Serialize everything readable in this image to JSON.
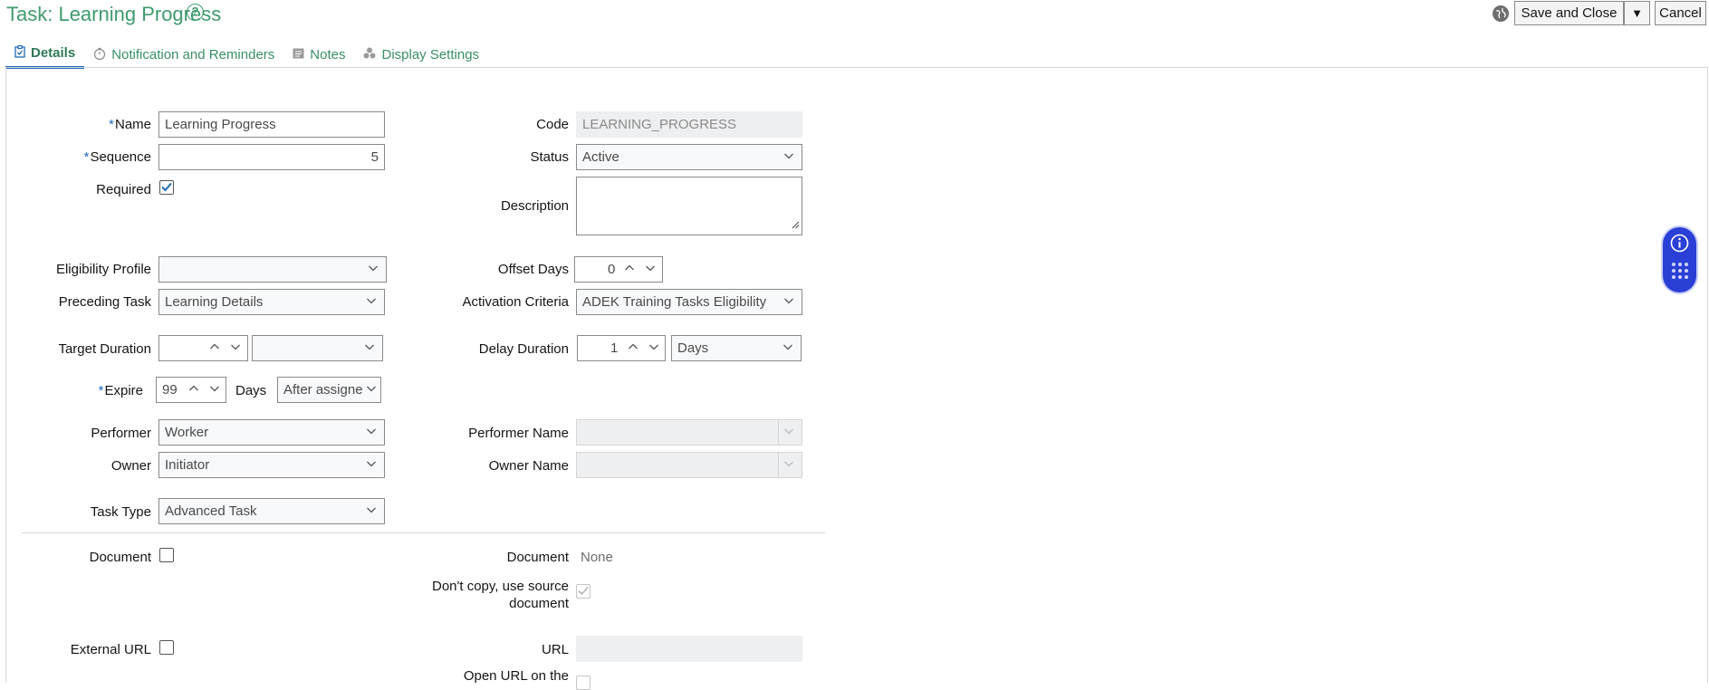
{
  "header": {
    "title": "Task: Learning Progress",
    "help_icon": "help-circle-icon",
    "globe_icon": "globe-icon",
    "save_close_label": "Save and Close",
    "save_menu_glyph": "▼",
    "cancel_label": "Cancel"
  },
  "tabs": [
    {
      "label": "Details",
      "icon": "clipboard-icon",
      "active": true
    },
    {
      "label": "Notification and Reminders",
      "icon": "timer-icon",
      "active": false
    },
    {
      "label": "Notes",
      "icon": "note-icon",
      "active": false
    },
    {
      "label": "Display Settings",
      "icon": "settings-cluster-icon",
      "active": false
    }
  ],
  "form": {
    "name": {
      "label": "Name",
      "required": true,
      "value": "Learning Progress"
    },
    "sequence": {
      "label": "Sequence",
      "required": true,
      "value": "5"
    },
    "required": {
      "label": "Required",
      "checked": true
    },
    "code": {
      "label": "Code",
      "value": "LEARNING_PROGRESS"
    },
    "status": {
      "label": "Status",
      "value": "Active"
    },
    "description": {
      "label": "Description",
      "value": ""
    },
    "eligibility_profile": {
      "label": "Eligibility Profile",
      "value": ""
    },
    "preceding_task": {
      "label": "Preceding Task",
      "value": "Learning Details"
    },
    "offset_days": {
      "label": "Offset Days",
      "value": "0"
    },
    "activation_criteria": {
      "label": "Activation Criteria",
      "value": "ADEK Training Tasks Eligibility"
    },
    "target_duration": {
      "label": "Target Duration",
      "value": "",
      "unit": ""
    },
    "delay_duration": {
      "label": "Delay Duration",
      "value": "1",
      "unit": "Days"
    },
    "expire": {
      "label": "Expire",
      "required": true,
      "value": "99",
      "unit_label": "Days",
      "relative": "After assigne"
    },
    "performer": {
      "label": "Performer",
      "value": "Worker"
    },
    "performer_name": {
      "label": "Performer Name",
      "value": ""
    },
    "owner": {
      "label": "Owner",
      "value": "Initiator"
    },
    "owner_name": {
      "label": "Owner Name",
      "value": ""
    },
    "task_type": {
      "label": "Task Type",
      "value": "Advanced Task"
    },
    "document_check": {
      "label": "Document",
      "checked": false
    },
    "document_value": {
      "label": "Document",
      "value": "None"
    },
    "dont_copy": {
      "label_line1": "Don't copy, use source",
      "label_line2": "document",
      "checked": true
    },
    "external_url": {
      "label": "External URL",
      "checked": false
    },
    "url": {
      "label": "URL",
      "value": ""
    },
    "open_url": {
      "label": "Open URL on the"
    }
  },
  "colors": {
    "accent_green": "#3f9b6e",
    "tab_underline": "#1e6ab8",
    "required_star": "#1e6ab8",
    "fab": "#2a3fd6"
  },
  "fab": {
    "icon_top": "info-icon",
    "icon_bottom": "grid-dots-icon"
  }
}
